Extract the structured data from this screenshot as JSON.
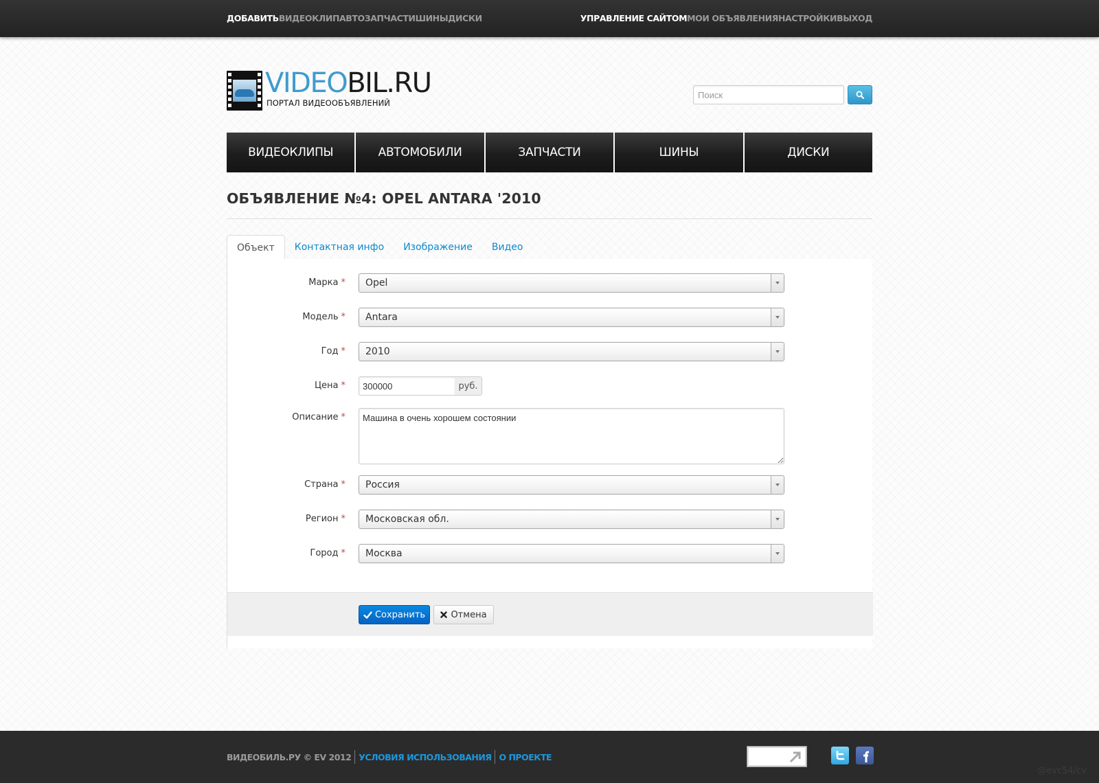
{
  "topbar": {
    "left": [
      {
        "label": "ДОБАВИТЬ"
      },
      {
        "label": "ВИДЕОКЛИП"
      },
      {
        "label": "АВТО"
      },
      {
        "label": "ЗАПЧАСТИ"
      },
      {
        "label": "ШИНЫ"
      },
      {
        "label": "ДИСКИ"
      }
    ],
    "right": [
      {
        "label": "УПРАВЛЕНИЕ САЙТОМ"
      },
      {
        "label": "МОИ ОБЪЯВЛЕНИЯ"
      },
      {
        "label": "НАСТРОЙКИ"
      },
      {
        "label": "ВЫХОД"
      }
    ]
  },
  "logo": {
    "name_part1": "VIDEO",
    "name_part2": "BIL.RU",
    "tagline": "ПОРТАЛ ВИДЕООБЪЯВЛЕНИЙ"
  },
  "search": {
    "placeholder": "Поиск",
    "icon": "search-icon"
  },
  "main_nav": [
    {
      "label": "ВИДЕОКЛИПЫ"
    },
    {
      "label": "АВТОМОБИЛИ"
    },
    {
      "label": "ЗАПЧАСТИ"
    },
    {
      "label": "ШИНЫ"
    },
    {
      "label": "ДИСКИ"
    }
  ],
  "page_title": "ОБЪЯВЛЕНИЕ №4: OPEL ANTARA '2010",
  "tabs": [
    {
      "label": "Объект",
      "active": true
    },
    {
      "label": "Контактная инфо",
      "active": false
    },
    {
      "label": "Изображение",
      "active": false
    },
    {
      "label": "Видео",
      "active": false
    }
  ],
  "form": {
    "required_mark": "*",
    "brand": {
      "label": "Марка",
      "value": "Opel"
    },
    "model": {
      "label": "Модель",
      "value": "Antara"
    },
    "year": {
      "label": "Год",
      "value": "2010"
    },
    "price": {
      "label": "Цена",
      "value": "300000",
      "currency": "руб."
    },
    "description": {
      "label": "Описание",
      "value": "Машина в очень хорошем состоянии"
    },
    "country": {
      "label": "Страна",
      "value": "Россия"
    },
    "region": {
      "label": "Регион",
      "value": "Московская обл."
    },
    "city": {
      "label": "Город",
      "value": "Москва"
    },
    "save_label": "Сохранить",
    "cancel_label": "Отмена"
  },
  "footer": {
    "copyright": "ВИДЕОБИЛЬ.РУ © EV 2012",
    "terms": "УСЛОВИЯ ИСПОЛЬЗОВАНИЯ",
    "about": "О ПРОЕКТЕ"
  },
  "watermark": "@evc54/cv",
  "colors": {
    "accent": "#2d9fd8",
    "link": "#0e88cc",
    "primary_button": "#0a75d6",
    "required": "#b94a48",
    "topbar": "#2a2a2a",
    "footer": "#2b2b2b"
  }
}
